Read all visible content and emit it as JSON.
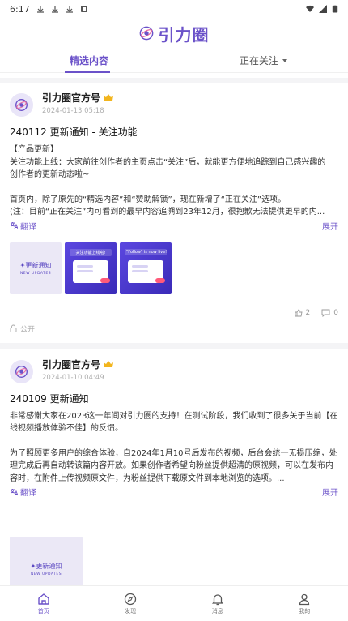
{
  "status_bar": {
    "time": "6:17"
  },
  "header": {
    "brand": "引力圈"
  },
  "tabs": {
    "featured": "精选内容",
    "following": "正在关注"
  },
  "posts": [
    {
      "author": "引力圈官方号",
      "time": "2024-01-13 05:18",
      "title": "240112 更新通知 - 关注功能",
      "body_lines": [
        "【产品更新】",
        "关注功能上线：大家前往创作者的主页点击“关注”后，就能更方便地追踪到自己感兴趣的",
        "创作者的更新动态啦~",
        "",
        "首页内，除了原先的“精选内容”和“赞助解锁”，现在新增了“正在关注”选项。",
        "(注：目前“正在关注”内可看到的最早内容追溯到23年12月，很抱歉无法提供更早的内..."
      ],
      "translate_label": "翻译",
      "expand_label": "展开",
      "thumbs": [
        {
          "kind": "new",
          "main": "更新通知",
          "sub": "NEW UPDATES"
        },
        {
          "kind": "purple",
          "label": "关注功能上线啦!"
        },
        {
          "kind": "purple",
          "label": "\"Follow\" is now live!"
        }
      ],
      "likes": "2",
      "comments": "0",
      "visibility": "公开"
    },
    {
      "author": "引力圈官方号",
      "time": "2024-01-10 04:49",
      "title": "240109 更新通知",
      "body_lines": [
        "非常感谢大家在2023这一年间对引力圈的支持！在测试阶段，我们收到了很多关于当前【在",
        "线视频播放体验不佳】的反馈。",
        "",
        "为了照顾更多用户的综合体验，自2024年1月10号后发布的视频，后台会统一无损压缩，处",
        "理完成后再自动转该篇内容开放。如果创作者希望向粉丝提供超清的原视频，可以在发布内",
        "容时，在附件上传视频原文件，为粉丝提供下载原文件到本地浏览的选项。..."
      ],
      "translate_label": "翻译",
      "expand_label": "展开",
      "thumbs": [
        {
          "kind": "new",
          "main": "更新通知",
          "sub": "NEW UPDATES"
        }
      ]
    }
  ],
  "bottom_nav": [
    {
      "label": "首页",
      "icon": "home-icon",
      "active": true
    },
    {
      "label": "发现",
      "icon": "compass-icon",
      "active": false
    },
    {
      "label": "消息",
      "icon": "bell-icon",
      "active": false
    },
    {
      "label": "我的",
      "icon": "user-icon",
      "active": false
    }
  ],
  "colors": {
    "accent": "#6b52c9",
    "crown": "#f2b51d"
  }
}
